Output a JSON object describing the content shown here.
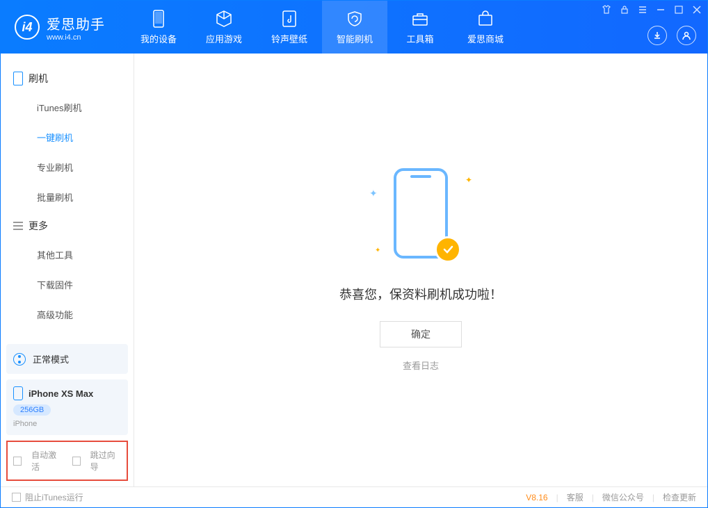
{
  "app": {
    "title": "爱思助手",
    "subtitle": "www.i4.cn"
  },
  "nav": {
    "tabs": [
      {
        "label": "我的设备"
      },
      {
        "label": "应用游戏"
      },
      {
        "label": "铃声壁纸"
      },
      {
        "label": "智能刷机"
      },
      {
        "label": "工具箱"
      },
      {
        "label": "爱思商城"
      }
    ]
  },
  "sidebar": {
    "section1_title": "刷机",
    "items1": [
      {
        "label": "iTunes刷机"
      },
      {
        "label": "一键刷机"
      },
      {
        "label": "专业刷机"
      },
      {
        "label": "批量刷机"
      }
    ],
    "section2_title": "更多",
    "items2": [
      {
        "label": "其他工具"
      },
      {
        "label": "下载固件"
      },
      {
        "label": "高级功能"
      }
    ]
  },
  "mode_card": {
    "label": "正常模式"
  },
  "device_card": {
    "name": "iPhone XS Max",
    "storage": "256GB",
    "type": "iPhone"
  },
  "options": {
    "auto_activate": "自动激活",
    "skip_guide": "跳过向导"
  },
  "main": {
    "success_text": "恭喜您，保资料刷机成功啦！",
    "ok_button": "确定",
    "log_link": "查看日志"
  },
  "statusbar": {
    "block_itunes": "阻止iTunes运行",
    "version": "V8.16",
    "links": [
      "客服",
      "微信公众号",
      "检查更新"
    ]
  }
}
